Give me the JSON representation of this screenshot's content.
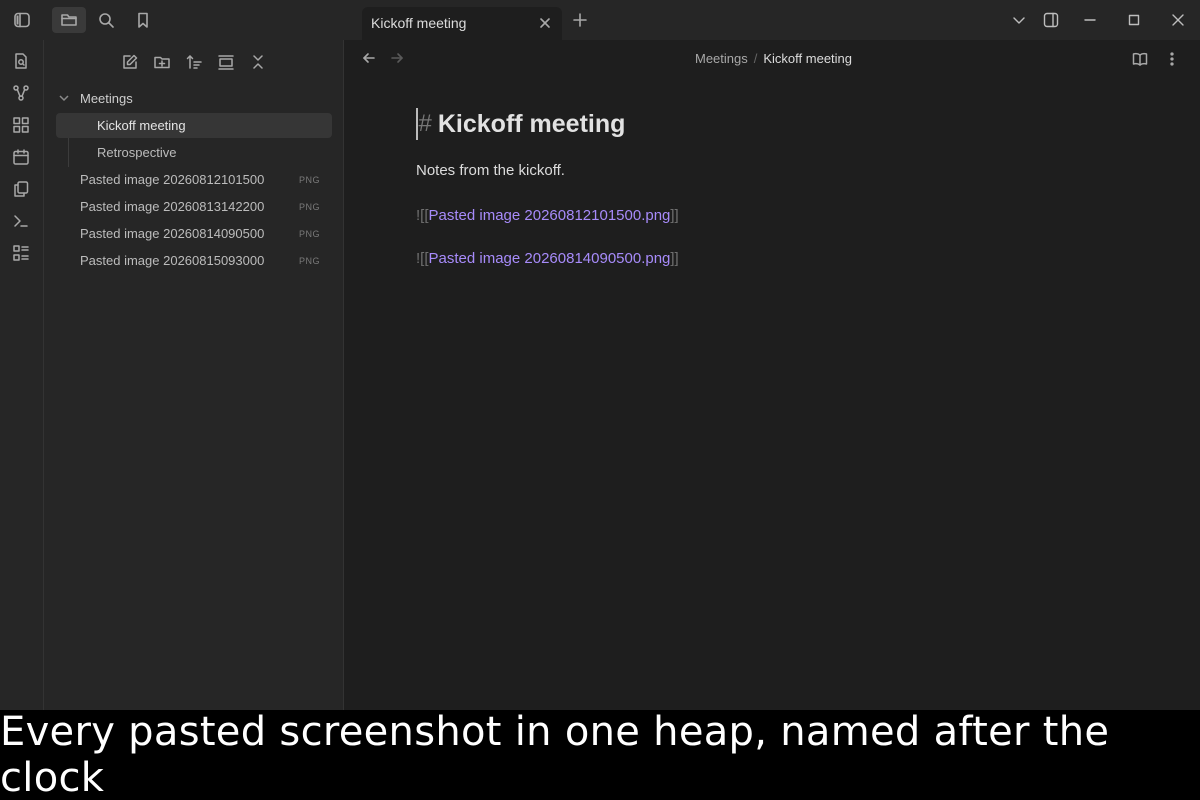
{
  "tab": {
    "title": "Kickoff meeting"
  },
  "sidebar": {
    "folder": "Meetings",
    "files_in_folder": [
      {
        "name": "Kickoff meeting",
        "active": true
      },
      {
        "name": "Retrospective",
        "active": false
      }
    ],
    "root_files": [
      {
        "name": "Pasted image 20260812101500",
        "ext": "PNG"
      },
      {
        "name": "Pasted image 20260813142200",
        "ext": "PNG"
      },
      {
        "name": "Pasted image 20260814090500",
        "ext": "PNG"
      },
      {
        "name": "Pasted image 20260815093000",
        "ext": "PNG"
      }
    ]
  },
  "breadcrumb": {
    "folder": "Meetings",
    "separator": "/",
    "current": "Kickoff meeting"
  },
  "editor": {
    "heading_marker": "#",
    "heading": "Kickoff meeting",
    "paragraph": "Notes from the kickoff.",
    "embeds": [
      {
        "open": "![[",
        "link": "Pasted image 20260812101500.png",
        "close": "]]"
      },
      {
        "open": "![[",
        "link": "Pasted image 20260814090500.png",
        "close": "]]"
      }
    ]
  },
  "caption": "Every pasted screenshot in one heap, named after the clock",
  "colors": {
    "link": "#a78bfa",
    "background": "#1e1e1e",
    "sidebar": "#262626"
  }
}
